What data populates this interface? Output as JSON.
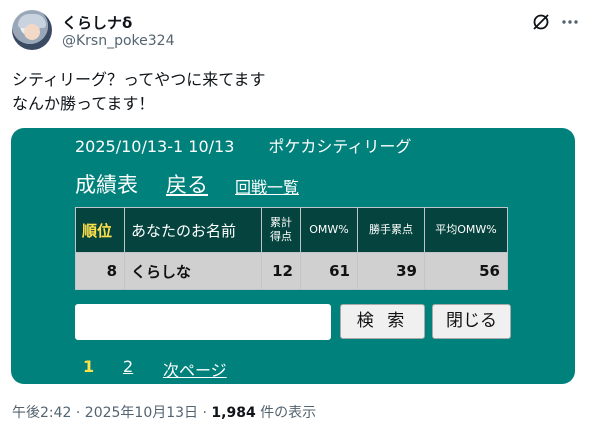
{
  "post": {
    "display_name": "くらしナδ",
    "handle": "@Krsn_poke324",
    "text_lines": [
      "シティリーグ？ってやつに来てます",
      "なんか勝ってます！"
    ],
    "posted_at": "午後2:42 · 2025年10月13日 · ",
    "views_count": "1,984",
    "views_suffix": " 件の表示"
  },
  "results_page": {
    "event_date": "2025/10/13-1 10/13",
    "event_title": "ポケカシティリーグ",
    "heading": "成績表",
    "back_link": "戻る",
    "rounds_link": "回戦一覧",
    "columns": {
      "rank": "順位",
      "name": "あなたのお名前",
      "points_line1": "累計",
      "points_line2": "得点",
      "omw": "OMW%",
      "win_points": "勝手累点",
      "avg_omw": "平均OMW%"
    },
    "rows": [
      {
        "rank": "8",
        "name": "くらしな",
        "points": "12",
        "omw": "61",
        "win_points": "39",
        "avg_omw": "56"
      }
    ],
    "search_value": "",
    "search_button": "検 索",
    "close_button": "閉じる",
    "pages": [
      "1",
      "2"
    ],
    "next_page": "次ページ"
  },
  "colors": {
    "card_background": "#00817b",
    "header_background": "#05443e",
    "accent_yellow": "#ffe14a",
    "row_background": "#cfd0cf"
  },
  "icons": [
    "grok-icon",
    "more-icon",
    "avatar"
  ]
}
